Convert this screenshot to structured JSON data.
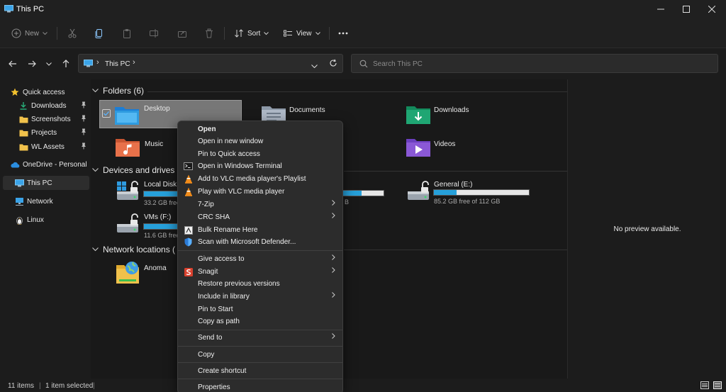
{
  "window": {
    "title": "This PC"
  },
  "toolbar": {
    "new": "New",
    "sort": "Sort",
    "view": "View"
  },
  "address": {
    "crumb": "This PC"
  },
  "search": {
    "placeholder": "Search This PC"
  },
  "sidebar": {
    "quick_access": "Quick access",
    "items": [
      "Downloads",
      "Screenshots",
      "Projects",
      "WL Assets"
    ],
    "onedrive": "OneDrive - Personal",
    "this_pc": "This PC",
    "network": "Network",
    "linux": "Linux"
  },
  "sections": {
    "folders": "Folders (6)",
    "devices": "Devices and drives (",
    "network": "Network locations ("
  },
  "folders": [
    {
      "label": "Desktop",
      "color": "#2e9be0"
    },
    {
      "label": "Documents",
      "color": "#aeb8c6"
    },
    {
      "label": "Downloads",
      "color": "#1fa673"
    },
    {
      "label": "Music",
      "color": "#e8714a"
    },
    {
      "label": "Videos",
      "color": "#8a58d6"
    }
  ],
  "drives": [
    {
      "label": "Local Disk (",
      "free": "33.2 GB free",
      "used_fraction": 0.7
    },
    {
      "label": "VMs (F:)",
      "free": "11.6 GB free",
      "used_fraction": 0.9
    },
    {
      "partial_free": "B",
      "used_fraction": 0.5
    },
    {
      "label": "General (E:)",
      "free": "85.2 GB free of 112 GB",
      "used_fraction": 0.24
    }
  ],
  "network_locations": [
    {
      "label": "Anoma"
    }
  ],
  "preview": {
    "message": "No preview available."
  },
  "status": {
    "items": "11 items",
    "selected": "1 item selected"
  },
  "context_menu": {
    "open": "Open",
    "open_new_window": "Open in new window",
    "pin_quick_access": "Pin to Quick access",
    "open_terminal": "Open in Windows Terminal",
    "vlc_playlist": "Add to VLC media player's Playlist",
    "vlc_play": "Play with VLC media player",
    "zip": "7-Zip",
    "crc": "CRC SHA",
    "bulk_rename": "Bulk Rename Here",
    "defender": "Scan with Microsoft Defender...",
    "give_access": "Give access to",
    "snagit": "Snagit",
    "restore": "Restore previous versions",
    "include_library": "Include in library",
    "pin_start": "Pin to Start",
    "copy_path": "Copy as path",
    "send_to": "Send to",
    "copy": "Copy",
    "create_shortcut": "Create shortcut",
    "properties": "Properties"
  },
  "colors": {
    "accent": "#26a0da",
    "vlc": "#f28c1a",
    "snagit": "#d9412e",
    "star": "#f2c12e"
  }
}
